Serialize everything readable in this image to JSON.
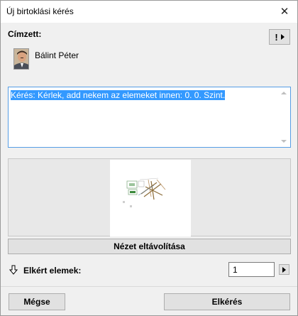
{
  "window": {
    "title": "Új birtoklási kérés",
    "close_icon": "close-icon"
  },
  "recipient": {
    "label": "Címzett:",
    "name": "Bálint Péter",
    "avatar_icon": "person-photo"
  },
  "message": {
    "text": "Kérés: Kérlek, add nekem az elemeket innen: 0. 0. Szint."
  },
  "preview": {
    "remove_view_label": "Nézet eltávolítása"
  },
  "requested": {
    "label": "Elkért elemek:",
    "count": "1"
  },
  "actions": {
    "cancel_label": "Mégse",
    "request_label": "Elkérés"
  },
  "colors": {
    "selection": "#3399ff",
    "focus_border": "#569de5",
    "button_face": "#e1e1e1"
  }
}
